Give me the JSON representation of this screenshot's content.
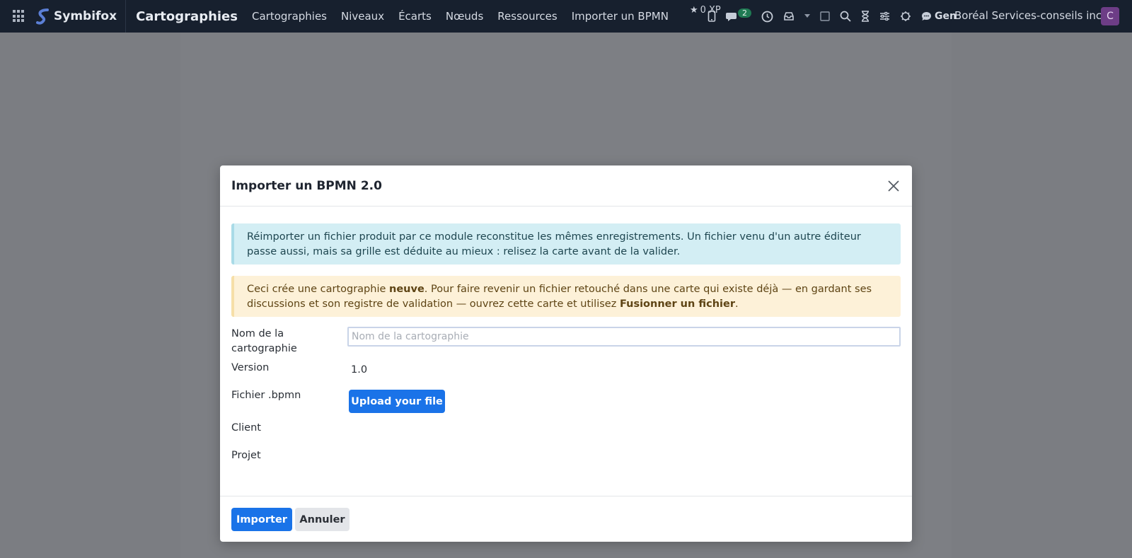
{
  "topbar": {
    "brand": "Symbifox",
    "app_title": "Cartographies",
    "nav": [
      "Cartographies",
      "Niveaux",
      "Écarts",
      "Nœuds",
      "Ressources",
      "Importer un BPMN"
    ],
    "xp": "0 XP",
    "messages_count": "2",
    "gen_label": "Gen",
    "company": "Boréal Services-conseils inc.",
    "avatar_initial": "C",
    "icons": [
      "apps-icon",
      "star-icon",
      "mobile-icon",
      "chat-icon",
      "clock-icon",
      "inbox-icon",
      "caret-down-icon",
      "square-icon",
      "search-icon",
      "hourglass-icon",
      "sliders-icon",
      "bug-icon",
      "comment-icon"
    ]
  },
  "modal": {
    "title": "Importer un BPMN 2.0",
    "info_text": "Réimporter un fichier produit par ce module reconstitue les mêmes enregistrements. Un fichier venu d'un autre éditeur passe aussi, mais sa grille est déduite au mieux : relisez la carte avant de la valider.",
    "warn_text_1": "Ceci crée une cartographie ",
    "warn_bold_1": "neuve",
    "warn_text_2": ". Pour faire revenir un fichier retouché dans une carte qui existe déjà — en gardant ses discussions et son registre de validation — ouvrez cette carte et utilisez ",
    "warn_bold_2": "Fusionner un fichier",
    "warn_text_3": ".",
    "fields": {
      "name_label": "Nom de la cartographie",
      "name_placeholder": "Nom de la cartographie",
      "name_value": "",
      "version_label": "Version",
      "version_value": "1.0",
      "file_label": "Fichier .bpmn",
      "upload_label": "Upload your file",
      "client_label": "Client",
      "project_label": "Projet"
    },
    "footer": {
      "import_label": "Importer",
      "cancel_label": "Annuler"
    }
  },
  "colors": {
    "topbar_bg": "#17202e",
    "primary": "#1a73e8",
    "info_bg": "#d3eef4",
    "warn_bg": "#fdf1d8",
    "overlay": "#7b7d82"
  }
}
